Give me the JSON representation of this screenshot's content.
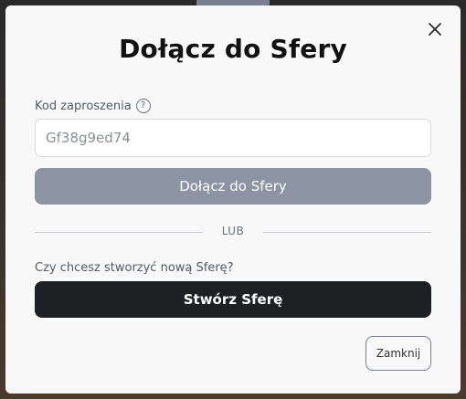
{
  "modal": {
    "title": "Dołącz do Sfery",
    "close_icon": "close-icon"
  },
  "invite": {
    "label": "Kod zaproszenia",
    "help_icon": "help-icon",
    "help_glyph": "?",
    "value": "",
    "placeholder": "Gf38g9ed74"
  },
  "join_button": {
    "label": "Dołącz do Sfery",
    "color": "#8c93a3"
  },
  "divider": {
    "text": "LUB"
  },
  "create": {
    "question": "Czy chcesz stworzyć nową Sferę?",
    "button_label": "Stwórz Sferę",
    "button_color": "#1f2023"
  },
  "footer": {
    "close_label": "Zamknij"
  }
}
